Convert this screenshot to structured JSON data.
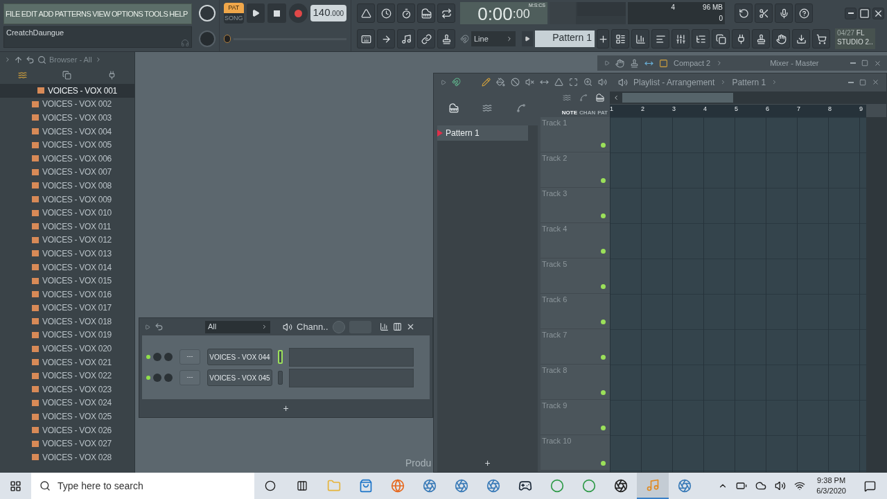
{
  "menu": [
    "FILE",
    "EDIT",
    "ADD",
    "PATTERNS",
    "VIEW",
    "OPTIONS",
    "TOOLS",
    "HELP"
  ],
  "hint": "CreatchDaungue",
  "transport": {
    "modes": [
      {
        "label": "PAT",
        "selected": true
      },
      {
        "label": "SONG",
        "selected": false
      }
    ],
    "tempo": "140",
    "tempo_fraction": ".000",
    "recording": false
  },
  "time": {
    "main": "0:00",
    "cs": ":00",
    "unit": "M:S:CS"
  },
  "cpu": {
    "voices": "4",
    "memory": "96 MB",
    "polyphony": "0"
  },
  "snap": "Line",
  "pattern": "Pattern 1",
  "news": {
    "date": "04/27",
    "line1": "FL",
    "line2": "STUDIO 2.."
  },
  "browser": {
    "title": "Browser - All",
    "items": [
      {
        "label": "VOICES - VOX 001",
        "selected": true
      },
      {
        "label": "VOICES - VOX 002",
        "selected": false
      },
      {
        "label": "VOICES - VOX 003",
        "selected": false
      },
      {
        "label": "VOICES - VOX 004",
        "selected": false
      },
      {
        "label": "VOICES - VOX 005",
        "selected": false
      },
      {
        "label": "VOICES - VOX 006",
        "selected": false
      },
      {
        "label": "VOICES - VOX 007",
        "selected": false
      },
      {
        "label": "VOICES - VOX 008",
        "selected": false
      },
      {
        "label": "VOICES - VOX 009",
        "selected": false
      },
      {
        "label": "VOICES - VOX 010",
        "selected": false
      },
      {
        "label": "VOICES - VOX 011",
        "selected": false
      },
      {
        "label": "VOICES - VOX 012",
        "selected": false
      },
      {
        "label": "VOICES - VOX 013",
        "selected": false
      },
      {
        "label": "VOICES - VOX 014",
        "selected": false
      },
      {
        "label": "VOICES - VOX 015",
        "selected": false
      },
      {
        "label": "VOICES - VOX 016",
        "selected": false
      },
      {
        "label": "VOICES - VOX 017",
        "selected": false
      },
      {
        "label": "VOICES - VOX 018",
        "selected": false
      },
      {
        "label": "VOICES - VOX 019",
        "selected": false
      },
      {
        "label": "VOICES - VOX 020",
        "selected": false
      },
      {
        "label": "VOICES - VOX 021",
        "selected": false
      },
      {
        "label": "VOICES - VOX 022",
        "selected": false
      },
      {
        "label": "VOICES - VOX 023",
        "selected": false
      },
      {
        "label": "VOICES - VOX 024",
        "selected": false
      },
      {
        "label": "VOICES - VOX 025",
        "selected": false
      },
      {
        "label": "VOICES - VOX 026",
        "selected": false
      },
      {
        "label": "VOICES - VOX 027",
        "selected": false
      },
      {
        "label": "VOICES - VOX 028",
        "selected": false
      }
    ]
  },
  "channel_rack": {
    "filter": "All",
    "title": "Chann..",
    "channels": [
      {
        "name": "VOICES - VOX 044",
        "route": "---",
        "on": true,
        "selected": true
      },
      {
        "name": "VOICES - VOX 045",
        "route": "---",
        "on": true,
        "selected": false
      }
    ],
    "add": "+"
  },
  "background_text": "Produ",
  "mixer": {
    "layout": "Compact 2",
    "title": "Mixer - Master"
  },
  "playlist": {
    "title": "Playlist - Arrangement",
    "pattern": "Pattern 1",
    "picker": [
      {
        "label": "Pattern 1",
        "selected": true
      }
    ],
    "add": "+",
    "modes": [
      "NOTE",
      "CHAN",
      "PAT"
    ],
    "bars": [
      "1",
      "2",
      "3",
      "4",
      "5",
      "6",
      "7",
      "8",
      "9"
    ],
    "tracks": [
      {
        "name": "Track 1",
        "on": true
      },
      {
        "name": "Track 2",
        "on": true
      },
      {
        "name": "Track 3",
        "on": true
      },
      {
        "name": "Track 4",
        "on": true
      },
      {
        "name": "Track 5",
        "on": true
      },
      {
        "name": "Track 6",
        "on": true
      },
      {
        "name": "Track 7",
        "on": true
      },
      {
        "name": "Track 8",
        "on": true
      },
      {
        "name": "Track 9",
        "on": true
      },
      {
        "name": "Track 10",
        "on": true
      }
    ]
  },
  "taskbar": {
    "search": "Type here to search",
    "time": "9:38 PM",
    "date": "6/3/2020",
    "apps": [
      {
        "kind": "explorer",
        "active": false
      },
      {
        "kind": "store",
        "active": false
      },
      {
        "kind": "firefox",
        "active": false
      },
      {
        "kind": "app",
        "active": false
      },
      {
        "kind": "app",
        "active": false
      },
      {
        "kind": "app",
        "active": false
      },
      {
        "kind": "steam",
        "active": false
      },
      {
        "kind": "chrome",
        "active": false
      },
      {
        "kind": "chrome",
        "active": false
      },
      {
        "kind": "obs",
        "active": false
      },
      {
        "kind": "fl",
        "active": true
      },
      {
        "kind": "app",
        "active": false
      }
    ]
  }
}
